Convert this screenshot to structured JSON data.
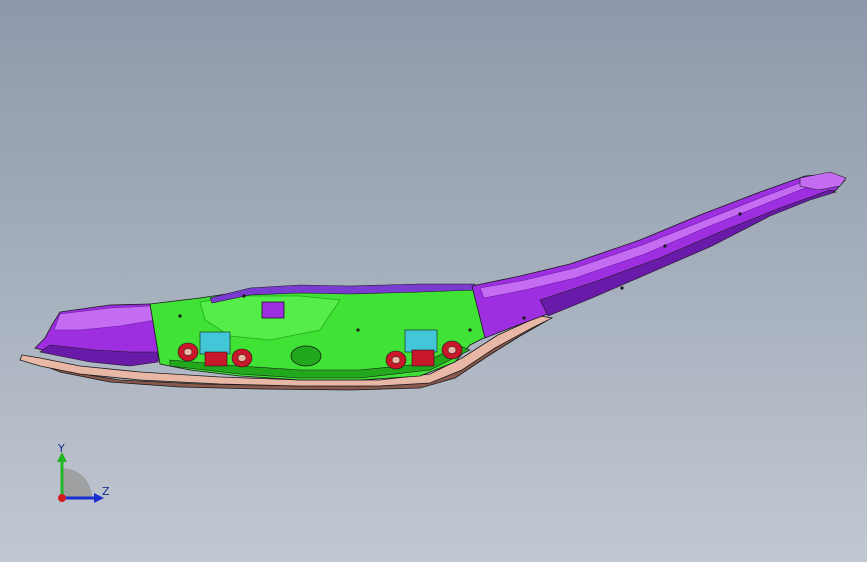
{
  "viewport": {
    "background_top": "#8d99aa",
    "background_bottom": "#c2c8d2"
  },
  "model": {
    "colors": {
      "purple_face": "#9d2fe0",
      "purple_light": "#c46cf2",
      "purple_dark": "#6a1aa8",
      "green_face": "#3fe235",
      "green_dark": "#22a81c",
      "flange": "#e9b7a6",
      "flange_dark": "#8a5a4e",
      "red_bracket": "#c8182a",
      "cyan_bracket": "#42c6d8",
      "edge_line": "#1a1a1a"
    }
  },
  "triad": {
    "y_label": "Y",
    "z_label": "Z",
    "icons": [
      "y-axis-arrow-icon",
      "z-axis-arrow-icon",
      "x-axis-dot-icon"
    ],
    "colors": {
      "y_axis": "#23b623",
      "z_axis": "#1c2fd0",
      "x_axis": "#d01c1c"
    }
  }
}
